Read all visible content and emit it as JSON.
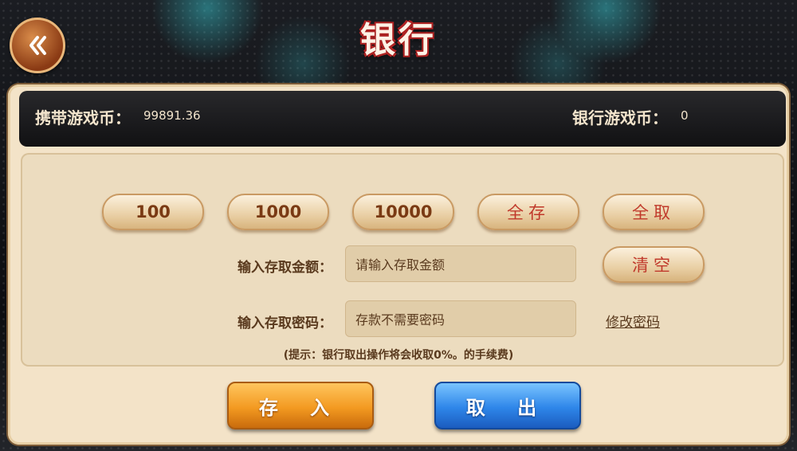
{
  "title": "银行",
  "header": {
    "carry_label": "携带游戏币：",
    "carry_value": "99891.36",
    "bank_label": "银行游戏币：",
    "bank_value": "0"
  },
  "amount_buttons": [
    "100",
    "1000",
    "10000",
    "全存",
    "全取"
  ],
  "amount_field": {
    "label": "输入存取金额：",
    "placeholder": "请输入存取金额"
  },
  "clear_button": "清空",
  "password_field": {
    "label": "输入存取密码：",
    "placeholder": "存款不需要密码"
  },
  "change_password_link": "修改密码",
  "hint": "(提示：银行取出操作将会收取0%。的手续费)",
  "actions": {
    "deposit": "存 入",
    "withdraw": "取 出"
  },
  "icons": {
    "back": "double-chevron-left-icon"
  },
  "colors": {
    "deposit_button": "#f39a21",
    "withdraw_button": "#2e86e9",
    "panel": "#f3e3c8"
  }
}
